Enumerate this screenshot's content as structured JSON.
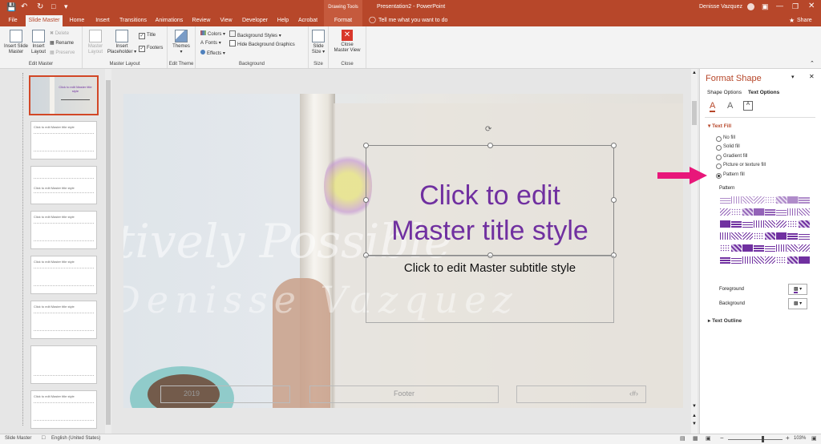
{
  "window": {
    "context_label": "Drawing Tools",
    "doc_title": "Presentation2 - PowerPoint",
    "user": "Denisse Vazquez"
  },
  "tabs": [
    "File",
    "Slide Master",
    "Home",
    "Insert",
    "Transitions",
    "Animations",
    "Review",
    "View",
    "Developer",
    "Help",
    "Acrobat"
  ],
  "context_tab": "Format",
  "tell_me": "Tell me what you want to do",
  "share_label": "Share",
  "ribbon": {
    "edit_master": {
      "label": "Edit Master",
      "insert_slide_master": [
        "Insert Slide",
        "Master"
      ],
      "insert_layout": [
        "Insert",
        "Layout"
      ],
      "delete": "Delete",
      "rename": "Rename",
      "preserve": "Preserve"
    },
    "master_layout": {
      "label": "Master Layout",
      "master_layout_btn": [
        "Master",
        "Layout"
      ],
      "insert_placeholder": [
        "Insert",
        "Placeholder"
      ],
      "title_chk": "Title",
      "footers_chk": "Footers"
    },
    "edit_theme": {
      "label": "Edit Theme",
      "themes": "Themes"
    },
    "background": {
      "label": "Background",
      "colors": "Colors",
      "fonts": "Fonts",
      "effects": "Effects",
      "background_styles": "Background Styles",
      "hide_bg": "Hide Background Graphics"
    },
    "size": {
      "label": "Size",
      "slide_size": [
        "Slide",
        "Size"
      ]
    },
    "close": {
      "label": "Close",
      "close_master": [
        "Close",
        "Master View"
      ]
    }
  },
  "thumb_texts": [
    "Click to edit Master title style",
    "Click to edit Master title style",
    "Click to edit Master title style",
    "Click to edit Master title style",
    "Click to edit Master title style",
    "",
    "Click to edit Master title style"
  ],
  "first_thumb_title": "Click to edit Master title style",
  "slide": {
    "title_line1": "Click to edit",
    "title_line2": "Master title style",
    "subtitle": "Click to edit Master subtitle style",
    "date": "2019",
    "footer": "Footer",
    "page_num": "‹#›",
    "watermark_line1": "Creatively Possible",
    "watermark_line2": "by Denisse Vazquez"
  },
  "format_pane": {
    "title": "Format Shape",
    "tab_shape": "Shape Options",
    "tab_text": "Text Options",
    "section_fill": "Text Fill",
    "options": [
      "No fill",
      "Solid fill",
      "Gradient fill",
      "Picture or texture fill",
      "Pattern fill"
    ],
    "selected_index": 4,
    "pattern_label": "Pattern",
    "foreground_label": "Foreground",
    "background_label": "Background",
    "section_outline": "Text Outline",
    "accent": "#b7472a",
    "pattern_color": "#7030a0"
  },
  "status": {
    "view": "Slide Master",
    "language": "English (United States)",
    "zoom": "103%"
  },
  "colors": {
    "titlebar": "#b7472a",
    "title_text": "#7030a0",
    "arrow": "#e8177a"
  }
}
